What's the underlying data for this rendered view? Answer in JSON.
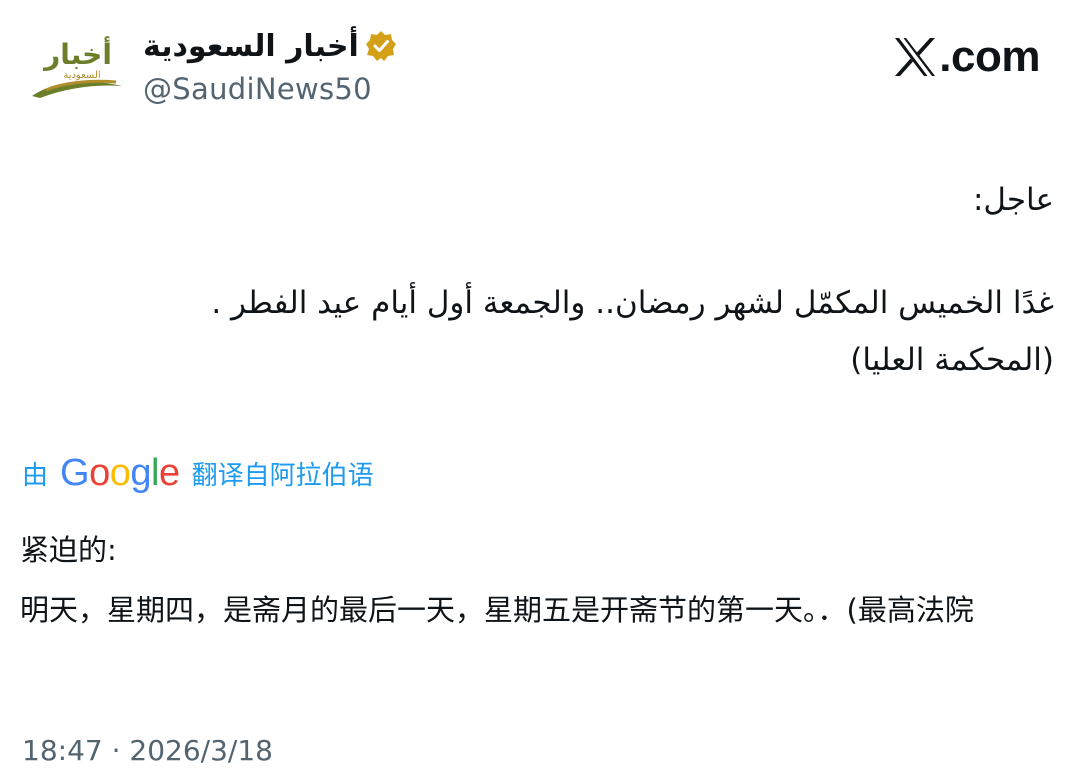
{
  "author": {
    "display_name": "أخبار السعودية",
    "handle": "@SaudiNews50",
    "verified_badge_color": "#d4a017",
    "avatar": {
      "label_top": "أخبار",
      "label_bottom": "السعودية",
      "text_color": "#6b7f2a",
      "icon": "saudi-news-logo-icon"
    }
  },
  "brand": {
    "icon": "x-logo-icon",
    "domain_text": ".com"
  },
  "tweet": {
    "label": "عاجل:",
    "line1": "غدًا الخميس المكمّل لشهر رمضان.. والجمعة أول أيام عيد الفطر .",
    "line2": "(المحكمة العليا)"
  },
  "translation": {
    "by_label": "由",
    "google_letters": [
      "G",
      "o",
      "o",
      "g",
      "l",
      "e"
    ],
    "from_label": "翻译自阿拉伯语",
    "link_color": "#1d9bf0",
    "label": "紧迫的:",
    "body": "明天，星期四，是斋月的最后一天，星期五是开斋节的第一天。．(最高法院"
  },
  "meta": {
    "timestamp": "18:47 · 2026/3/18"
  }
}
